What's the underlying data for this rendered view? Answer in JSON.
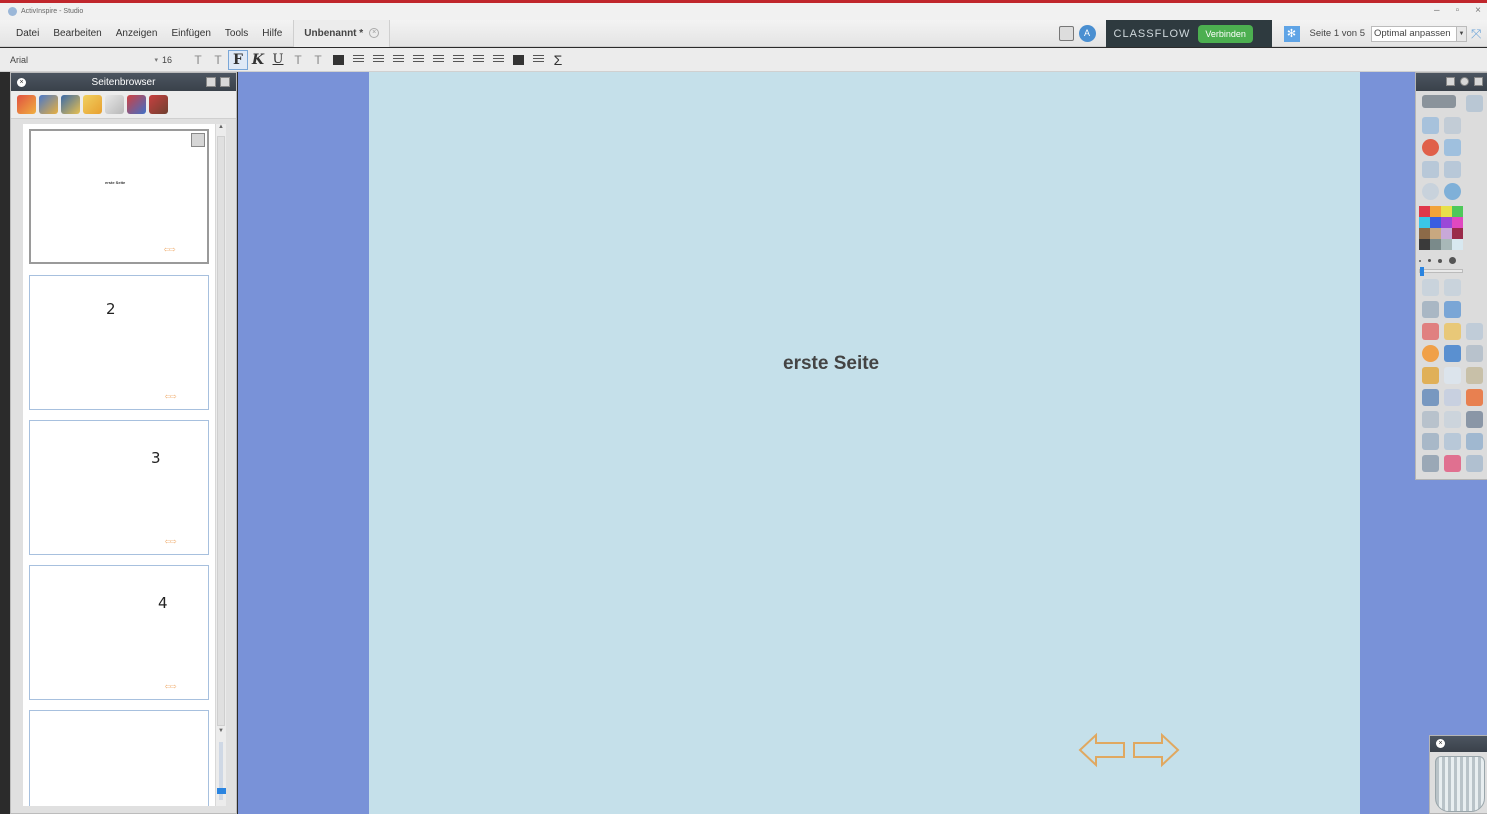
{
  "window": {
    "title": "ActivInspire - Studio"
  },
  "window_buttons": [
    "–",
    "▫",
    "×"
  ],
  "menu": [
    "Datei",
    "Bearbeiten",
    "Anzeigen",
    "Einfügen",
    "Tools",
    "Hilfe"
  ],
  "doc_tab": {
    "label": "Unbenannt *",
    "close": "×"
  },
  "classflow": {
    "logo": "CLASSFLOW",
    "connect": "Verbinden"
  },
  "page_info": "Seite 1 von 5",
  "zoom": {
    "value": "Optimal anpassen"
  },
  "format": {
    "font": "Arial",
    "size": "16",
    "bold": "F",
    "italic": "K",
    "underline": "U",
    "superscript": "T",
    "subscript": "T",
    "grow": "T",
    "shrink": "T",
    "sigma": "Σ"
  },
  "page_browser": {
    "title": "Seitenbrowser",
    "pages": [
      {
        "label": "erste Seite",
        "mark": ""
      },
      {
        "label": "",
        "mark": "2"
      },
      {
        "label": "",
        "mark": "3"
      },
      {
        "label": "",
        "mark": "4"
      },
      {
        "label": "",
        "mark": ""
      }
    ]
  },
  "canvas": {
    "text": "erste Seite"
  },
  "palette_colors": [
    "#e0384a",
    "#f2a33a",
    "#e8e04a",
    "#4ec85a",
    "#3ac6e8",
    "#3a5ee0",
    "#9a48d8",
    "#e048c0",
    "#8c6a48",
    "#c8a880",
    "#c8a8d8",
    "#9a2a4a",
    "#3a3a3a",
    "#7a8a8a",
    "#a8b8b8",
    "#d8e8f0"
  ],
  "accent": "#4caf50"
}
